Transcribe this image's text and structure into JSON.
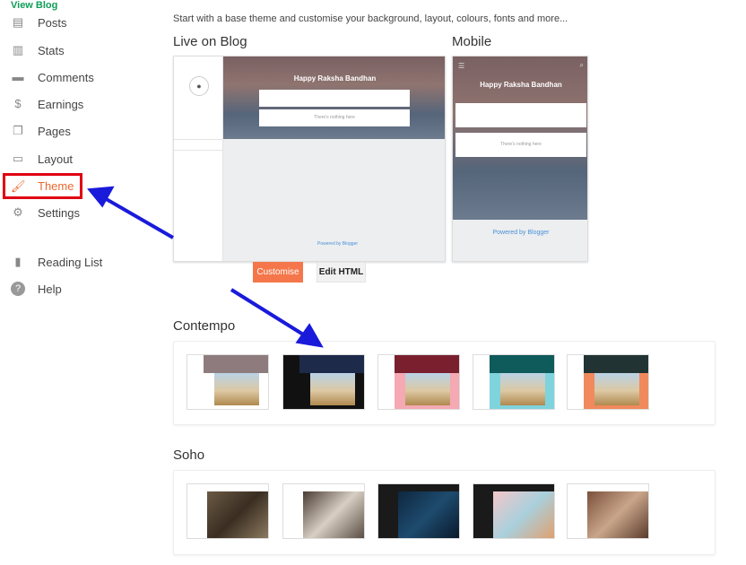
{
  "sidebar": {
    "top_link": "View Blog",
    "items": [
      {
        "label": "Posts",
        "icon": "posts-icon"
      },
      {
        "label": "Stats",
        "icon": "stats-icon"
      },
      {
        "label": "Comments",
        "icon": "comments-icon"
      },
      {
        "label": "Earnings",
        "icon": "dollar-icon"
      },
      {
        "label": "Pages",
        "icon": "pages-icon"
      },
      {
        "label": "Layout",
        "icon": "layout-icon"
      },
      {
        "label": "Theme",
        "icon": "paint-roller-icon",
        "active": true
      },
      {
        "label": "Settings",
        "icon": "gear-icon"
      },
      {
        "label": "Reading List",
        "icon": "bookmark-icon"
      },
      {
        "label": "Help",
        "icon": "help-icon"
      }
    ]
  },
  "main": {
    "subtitle": "Start with a base theme and customise your background, layout, colours, fonts and more...",
    "live_label": "Live on Blog",
    "mobile_label": "Mobile",
    "blog_title": "Happy Raksha Bandhan",
    "empty_text": "There's nothing here",
    "powered_by": "Powered by Blogger",
    "customise_label": "Customise",
    "edit_html_label": "Edit HTML",
    "sections": [
      {
        "title": "Contempo"
      },
      {
        "title": "Soho"
      }
    ]
  },
  "colors": {
    "accent": "#f4764a",
    "active": "#e8692f",
    "highlight_box": "#e00012",
    "arrow": "#1a1adb"
  }
}
